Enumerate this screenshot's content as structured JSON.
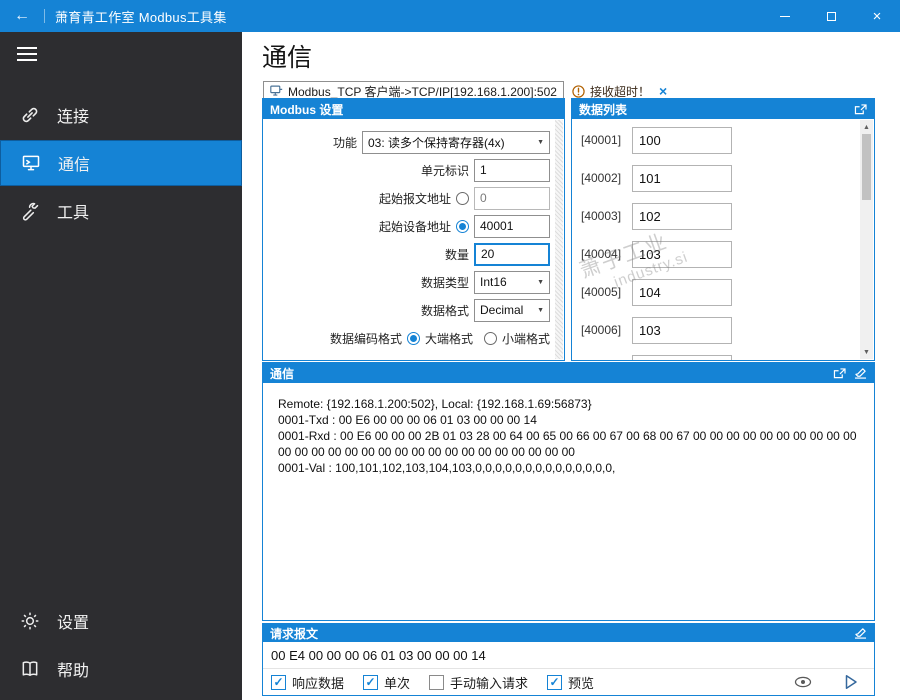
{
  "colors": {
    "accent": "#1583d5",
    "sidebar": "#2d2d30"
  },
  "icons": {
    "back": "←",
    "close": "×",
    "minimize": "–",
    "maximize": "□",
    "caret": "▼",
    "up": "▲",
    "down": "▼",
    "check": "✓",
    "tab_close": "×",
    "info": "!"
  },
  "titlebar": {
    "title": "萧育青工作室 Modbus工具集"
  },
  "sidebar": {
    "items": [
      {
        "label": "连接"
      },
      {
        "label": "通信"
      },
      {
        "label": "工具"
      }
    ],
    "bottom_items": [
      {
        "label": "设置"
      },
      {
        "label": "帮助"
      }
    ]
  },
  "page": {
    "title": "通信"
  },
  "connection_tab": {
    "label": "Modbus_TCP 客户端->TCP/IP[192.168.1.200]:502",
    "status": "接收超时！"
  },
  "settings": {
    "title": "Modbus 设置",
    "function": {
      "label": "功能",
      "value": "03: 读多个保持寄存器(4x)"
    },
    "unit_id": {
      "label": "单元标识",
      "value": "1"
    },
    "start_msg_addr": {
      "label": "起始报文地址",
      "value": "0",
      "selected": false
    },
    "start_dev_addr": {
      "label": "起始设备地址",
      "value": "40001",
      "selected": true
    },
    "quantity": {
      "label": "数量",
      "value": "20"
    },
    "data_type": {
      "label": "数据类型",
      "value": "Int16"
    },
    "data_format": {
      "label": "数据格式",
      "value": "Decimal"
    },
    "encoding": {
      "label": "数据编码格式",
      "big": "大端格式",
      "little": "小端格式",
      "selected": "big"
    }
  },
  "data_list": {
    "title": "数据列表",
    "items": [
      {
        "addr": "[40001]",
        "value": "100"
      },
      {
        "addr": "[40002]",
        "value": "101"
      },
      {
        "addr": "[40003]",
        "value": "102"
      },
      {
        "addr": "[40004]",
        "value": "103"
      },
      {
        "addr": "[40005]",
        "value": "104"
      },
      {
        "addr": "[40006]",
        "value": "103"
      }
    ]
  },
  "comm_log": {
    "title": "通信",
    "lines": [
      "Remote: {192.168.1.200:502}, Local: {192.168.1.69:56873}",
      "0001-Txd : 00 E6 00 00 00 06 01 03 00 00 00 14",
      "0001-Rxd : 00 E6 00 00 00 2B 01 03 28 00 64 00 65 00 66 00 67 00 68 00 67 00 00 00 00 00 00 00 00 00 00 00 00 00 00 00 00 00 00 00 00 00 00 00 00 00 00 00 00",
      "0001-Val : 100,101,102,103,104,103,0,0,0,0,0,0,0,0,0,0,0,0,0,0,"
    ]
  },
  "request": {
    "title": "请求报文",
    "value": "00 E4 00 00 00 06 01 03 00 00 00 14",
    "checkboxes": [
      {
        "label": "响应数据",
        "checked": true
      },
      {
        "label": "单次",
        "checked": true
      },
      {
        "label": "手动输入请求",
        "checked": false
      },
      {
        "label": "预览",
        "checked": true
      }
    ]
  },
  "watermark": {
    "line1": "萧子工业",
    "line2": "industry.si"
  }
}
